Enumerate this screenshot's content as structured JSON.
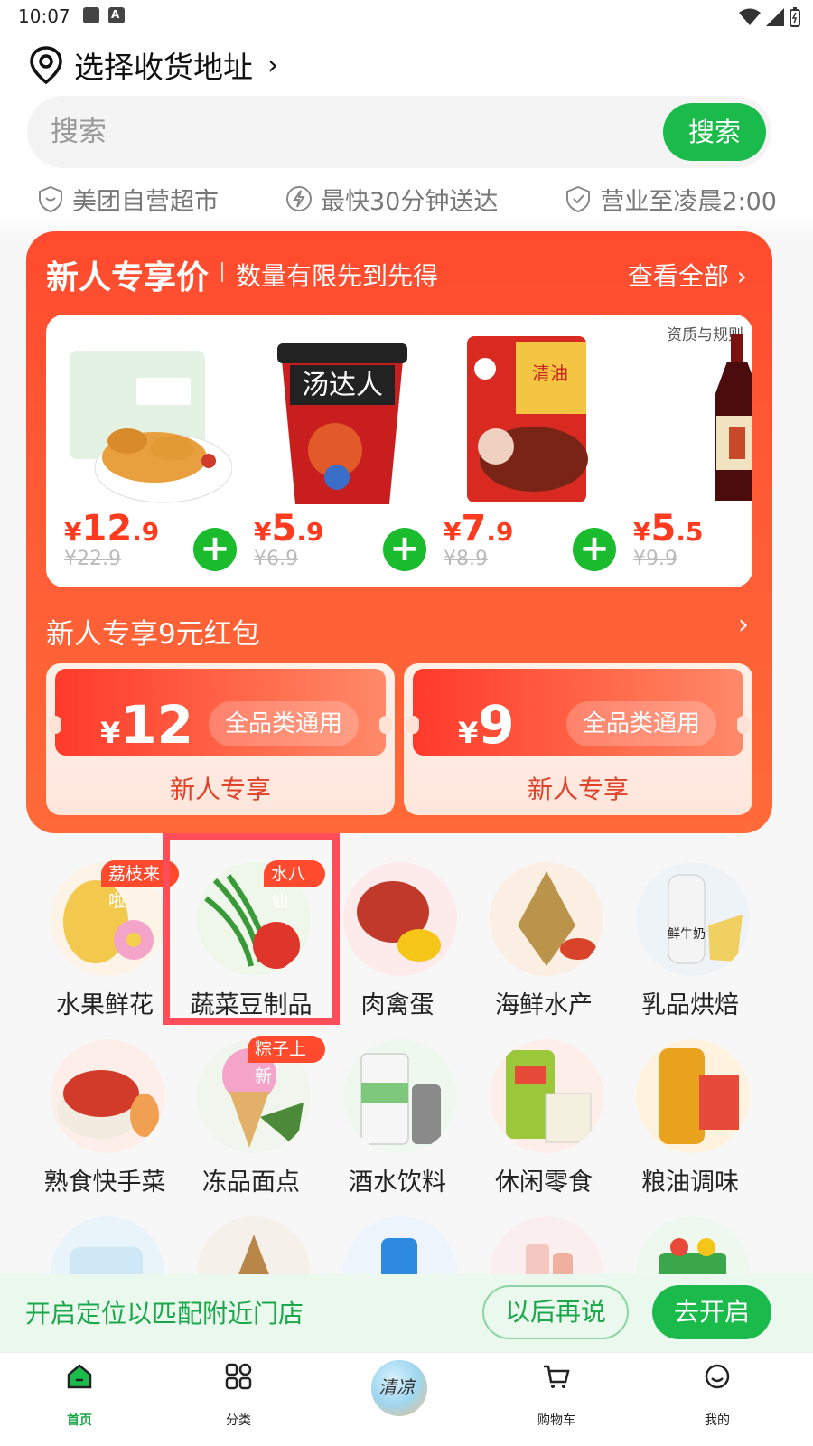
{
  "status_bar": {
    "time": "10:07",
    "left_icons": [
      "image-icon",
      "a-badge-icon"
    ],
    "right_icons": [
      "wifi-icon",
      "signal-icon",
      "battery-icon"
    ]
  },
  "address": {
    "label": "选择收货地址",
    "icon": "location-pin-icon",
    "chevron": "›"
  },
  "search": {
    "placeholder": "搜索",
    "button_label": "搜索"
  },
  "features": [
    {
      "icon": "heart-shield-icon",
      "label": "美团自营超市"
    },
    {
      "icon": "lightning-icon",
      "label": "最快30分钟送达"
    },
    {
      "icon": "check-shield-icon",
      "label": "营业至凌晨2:00"
    }
  ],
  "promo": {
    "title": "新人专享价",
    "subtitle": "数量有限先到先得",
    "view_all": "查看全部 ›",
    "qualification_link": "资质与规则",
    "products": [
      {
        "name": "脆皮炸鸡",
        "price_int": "12",
        "price_dec": ".9",
        "original_price": "¥22.9"
      },
      {
        "name": "汤达人",
        "price_int": "5",
        "price_dec": ".9",
        "original_price": "¥6.9"
      },
      {
        "name": "清油火锅底料",
        "price_int": "7",
        "price_dec": ".9",
        "original_price": "¥8.9"
      },
      {
        "name": "酱油",
        "price_int": "5",
        "price_dec": ".5",
        "original_price": "¥9.9"
      }
    ],
    "currency": "¥",
    "add_label": "+",
    "redpacket_title": "新人专享9元红包",
    "coupons": [
      {
        "currency": "¥",
        "amount": "12",
        "tag": "全品类通用",
        "caption": "新人专享"
      },
      {
        "currency": "¥",
        "amount": "9",
        "tag": "全品类通用",
        "caption": "新人专享"
      }
    ]
  },
  "categories": [
    {
      "label": "水果鲜花",
      "badge": "荔枝来啦",
      "color": "#f2c94c"
    },
    {
      "label": "蔬菜豆制品",
      "badge": "水八仙",
      "color": "#3a9a3a"
    },
    {
      "label": "肉禽蛋",
      "badge": "",
      "color": "#c0392b"
    },
    {
      "label": "海鲜水产",
      "badge": "",
      "color": "#b9944a"
    },
    {
      "label": "乳品烘焙",
      "badge": "",
      "color": "#f0d060"
    },
    {
      "label": "熟食快手菜",
      "badge": "",
      "color": "#d23b2a"
    },
    {
      "label": "冻品面点",
      "badge": "粽子上新",
      "color": "#f3a4c8"
    },
    {
      "label": "酒水饮料",
      "badge": "",
      "color": "#7ec87e"
    },
    {
      "label": "休闲零食",
      "badge": "",
      "color": "#e84a3a"
    },
    {
      "label": "粮油调味",
      "badge": "",
      "color": "#e8a21e"
    }
  ],
  "location_banner": {
    "text": "开启定位以匹配附近门店",
    "later_label": "以后再说",
    "enable_label": "去开启"
  },
  "bottom_nav": [
    {
      "label": "首页",
      "icon": "home-icon",
      "active": true
    },
    {
      "label": "分类",
      "icon": "grid-icon",
      "active": false
    },
    {
      "label": "清凉",
      "icon": "summer-promo-icon",
      "active": false
    },
    {
      "label": "购物车",
      "icon": "cart-icon",
      "active": false
    },
    {
      "label": "我的",
      "icon": "profile-icon",
      "active": false
    }
  ],
  "colors": {
    "brand_green": "#1bbb4b",
    "promo_red": "#ff4a2e",
    "highlight": "#ff4d5a"
  }
}
